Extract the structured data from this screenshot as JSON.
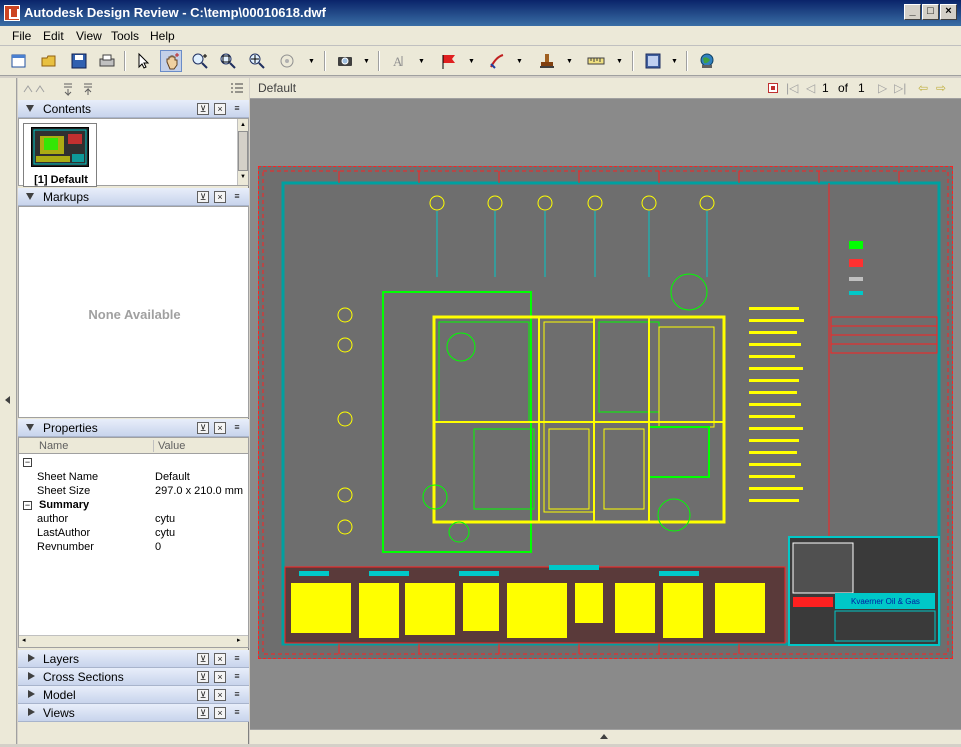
{
  "window": {
    "title": "Autodesk Design Review - C:\\temp\\00010618.dwf"
  },
  "menu": [
    "File",
    "Edit",
    "View",
    "Tools",
    "Help"
  ],
  "panels": {
    "contents": {
      "label": "Contents",
      "thumb_caption": "[1] Default"
    },
    "markups": {
      "label": "Markups",
      "empty_text": "None Available"
    },
    "properties": {
      "label": "Properties",
      "col_name": "Name",
      "col_value": "Value",
      "rows": [
        {
          "name": "Sheet Name",
          "value": "Default"
        },
        {
          "name": "Sheet Size",
          "value": "297.0 x 210.0 mm"
        }
      ],
      "group": "Summary",
      "summary_rows": [
        {
          "name": "author",
          "value": "cytu"
        },
        {
          "name": "LastAuthor",
          "value": "cytu"
        },
        {
          "name": "Revnumber",
          "value": "0"
        }
      ]
    },
    "collapsed": [
      "Layers",
      "Cross Sections",
      "Model",
      "Views"
    ]
  },
  "document": {
    "sheet_name": "Default",
    "page_current": "1",
    "page_of": "of",
    "page_total": "1",
    "titleblock_company": "Kvaerner Oil & Gas"
  },
  "colors": {
    "accent": "#0a246a",
    "drawing_bg": "#6e6e6e",
    "border_red": "#ff2020",
    "cyan": "#00c8c8",
    "yellow": "#ffff00",
    "green": "#00ff00"
  }
}
